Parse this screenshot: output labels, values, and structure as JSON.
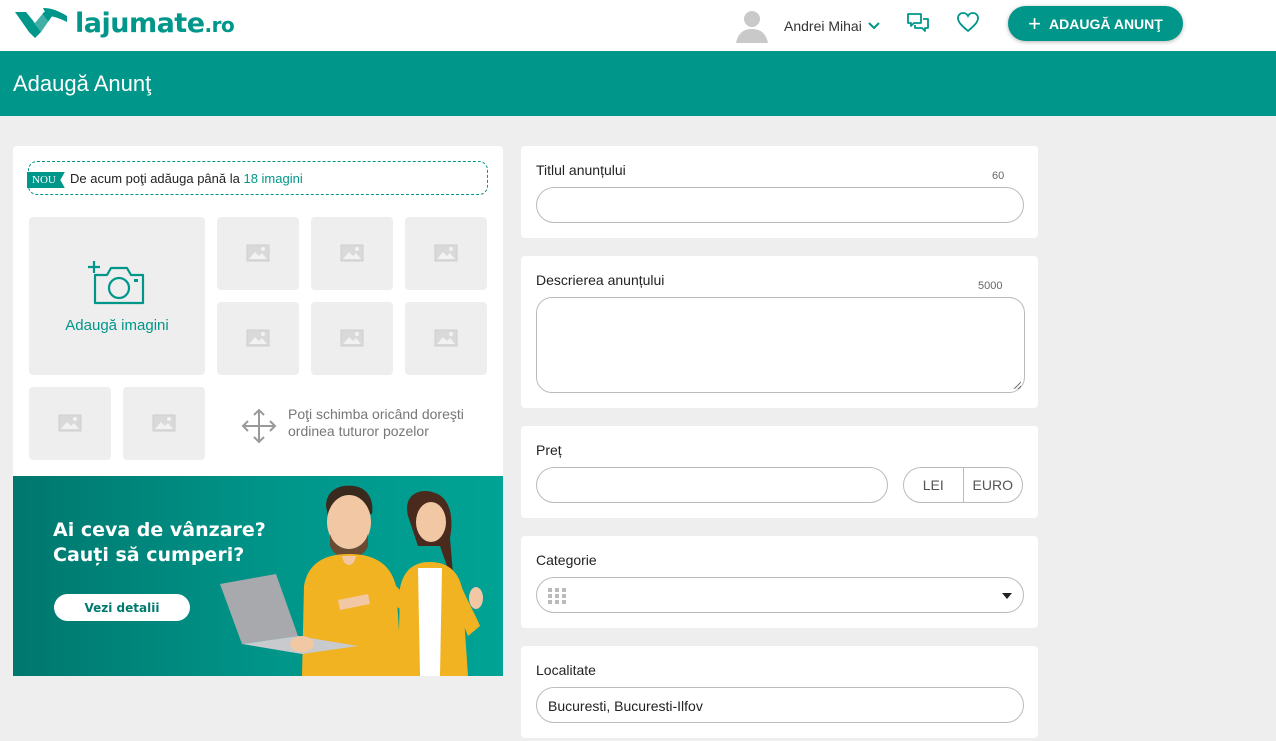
{
  "header": {
    "logo_main": "lajumate",
    "logo_suffix": ".ro",
    "user_name": "Andrei Mihai",
    "add_button": "ADAUGĂ ANUNŢ"
  },
  "page": {
    "title": "Adaugă Anunţ"
  },
  "images": {
    "badge": "NOU",
    "notice_text": "De acum poţi adăuga până la ",
    "notice_highlight": "18 imagini",
    "add_label": "Adaugă imagini",
    "reorder_line1": "Poţi schimba oricând doreşti",
    "reorder_line2": "ordinea tuturor pozelor"
  },
  "promo": {
    "line1": "Ai ceva de vânzare?",
    "line2": "Cauți să cumperi?",
    "button": "Vezi detalii"
  },
  "form": {
    "title": {
      "label": "Titlul anunțului",
      "counter": "60",
      "value": ""
    },
    "description": {
      "label": "Descrierea anunțului",
      "counter": "5000",
      "value": ""
    },
    "price": {
      "label": "Preț",
      "value": "",
      "currencies": [
        "LEI",
        "EURO"
      ]
    },
    "category": {
      "label": "Categorie",
      "value": ""
    },
    "location": {
      "label": "Localitate",
      "value": "Bucuresti, Bucuresti-Ilfov"
    }
  },
  "colors": {
    "brand": "#00968a",
    "background": "#eeeeee"
  }
}
